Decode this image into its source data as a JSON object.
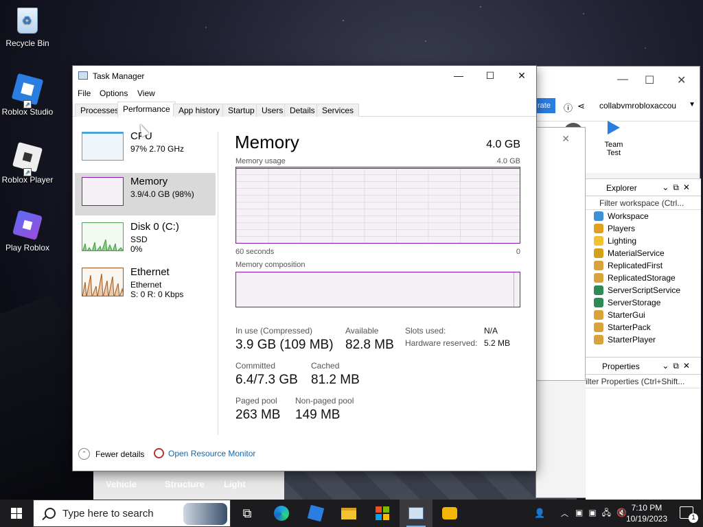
{
  "desktop": {
    "icons": [
      {
        "label": "Recycle Bin",
        "icon": "recycle-bin-icon"
      },
      {
        "label": "Roblox Studio",
        "icon": "roblox-studio-icon"
      },
      {
        "label": "Roblox Player",
        "icon": "roblox-player-icon"
      },
      {
        "label": "Play Roblox",
        "icon": "play-roblox-icon"
      }
    ]
  },
  "studio": {
    "account": "collabvmrobloxaccou",
    "share_label": "rate",
    "team_test_line1": "Team",
    "team_test_line2": "Test",
    "explorer": {
      "title": "Explorer",
      "filter_placeholder": "Filter workspace (Ctrl...",
      "items": [
        {
          "label": "Workspace",
          "color": "#3d8fd6"
        },
        {
          "label": "Players",
          "color": "#e0a020"
        },
        {
          "label": "Lighting",
          "color": "#f2c230"
        },
        {
          "label": "MaterialService",
          "color": "#d4a017"
        },
        {
          "label": "ReplicatedFirst",
          "color": "#d9a33b"
        },
        {
          "label": "ReplicatedStorage",
          "color": "#d9a33b"
        },
        {
          "label": "ServerScriptService",
          "color": "#2e8b57"
        },
        {
          "label": "ServerStorage",
          "color": "#2e8b57"
        },
        {
          "label": "StarterGui",
          "color": "#d9a33b"
        },
        {
          "label": "StarterPack",
          "color": "#d9a33b"
        },
        {
          "label": "StarterPlayer",
          "color": "#d9a33b"
        }
      ]
    },
    "properties": {
      "title": "Properties",
      "filter_placeholder": "ilter Properties (Ctrl+Shift..."
    },
    "toolbox_tiles": [
      {
        "label": "Vehicle",
        "color": "#c23b3b"
      },
      {
        "label": "Structure",
        "color": "#2cb5c2"
      },
      {
        "label": "Light",
        "color": "#c9c9c9"
      }
    ]
  },
  "task_manager": {
    "title": "Task Manager",
    "menu": [
      "File",
      "Options",
      "View"
    ],
    "tabs": [
      "Processes",
      "Performance",
      "App history",
      "Startup",
      "Users",
      "Details",
      "Services"
    ],
    "active_tab": "Performance",
    "resources": [
      {
        "name": "CPU",
        "sub1": "97%  2.70 GHz",
        "sub2": ""
      },
      {
        "name": "Memory",
        "sub1": "3.9/4.0 GB (98%)",
        "sub2": ""
      },
      {
        "name": "Disk 0 (C:)",
        "sub1": "SSD",
        "sub2": "0%"
      },
      {
        "name": "Ethernet",
        "sub1": "Ethernet",
        "sub2": "S: 0 R: 0 Kbps"
      }
    ],
    "memory": {
      "title": "Memory",
      "capacity": "4.0 GB",
      "usage_label": "Memory usage",
      "usage_max": "4.0 GB",
      "time_left": "60 seconds",
      "time_right": "0",
      "composition_label": "Memory composition",
      "composition_fill_fraction": 0.98,
      "stats": {
        "in_use_label": "In use (Compressed)",
        "in_use_value": "3.9 GB (109 MB)",
        "available_label": "Available",
        "available_value": "82.8 MB",
        "committed_label": "Committed",
        "committed_value": "6.4/7.3 GB",
        "cached_label": "Cached",
        "cached_value": "81.2 MB",
        "paged_label": "Paged pool",
        "paged_value": "263 MB",
        "nonpaged_label": "Non-paged pool",
        "nonpaged_value": "149 MB",
        "slots_label": "Slots used:",
        "slots_value": "N/A",
        "hw_reserved_label": "Hardware reserved:",
        "hw_reserved_value": "5.2 MB"
      }
    },
    "footer": {
      "fewer_details": "Fewer details",
      "open_resmon": "Open Resource Monitor"
    }
  },
  "taskbar": {
    "search_placeholder": "Type here to search",
    "apps": [
      "task-view-icon",
      "edge-icon",
      "roblox-studio-icon",
      "file-explorer-icon",
      "microsoft-store-icon",
      "task-manager-icon",
      "game-icon"
    ],
    "time": "7:10 PM",
    "date": "10/19/2023",
    "notification_count": "1"
  }
}
